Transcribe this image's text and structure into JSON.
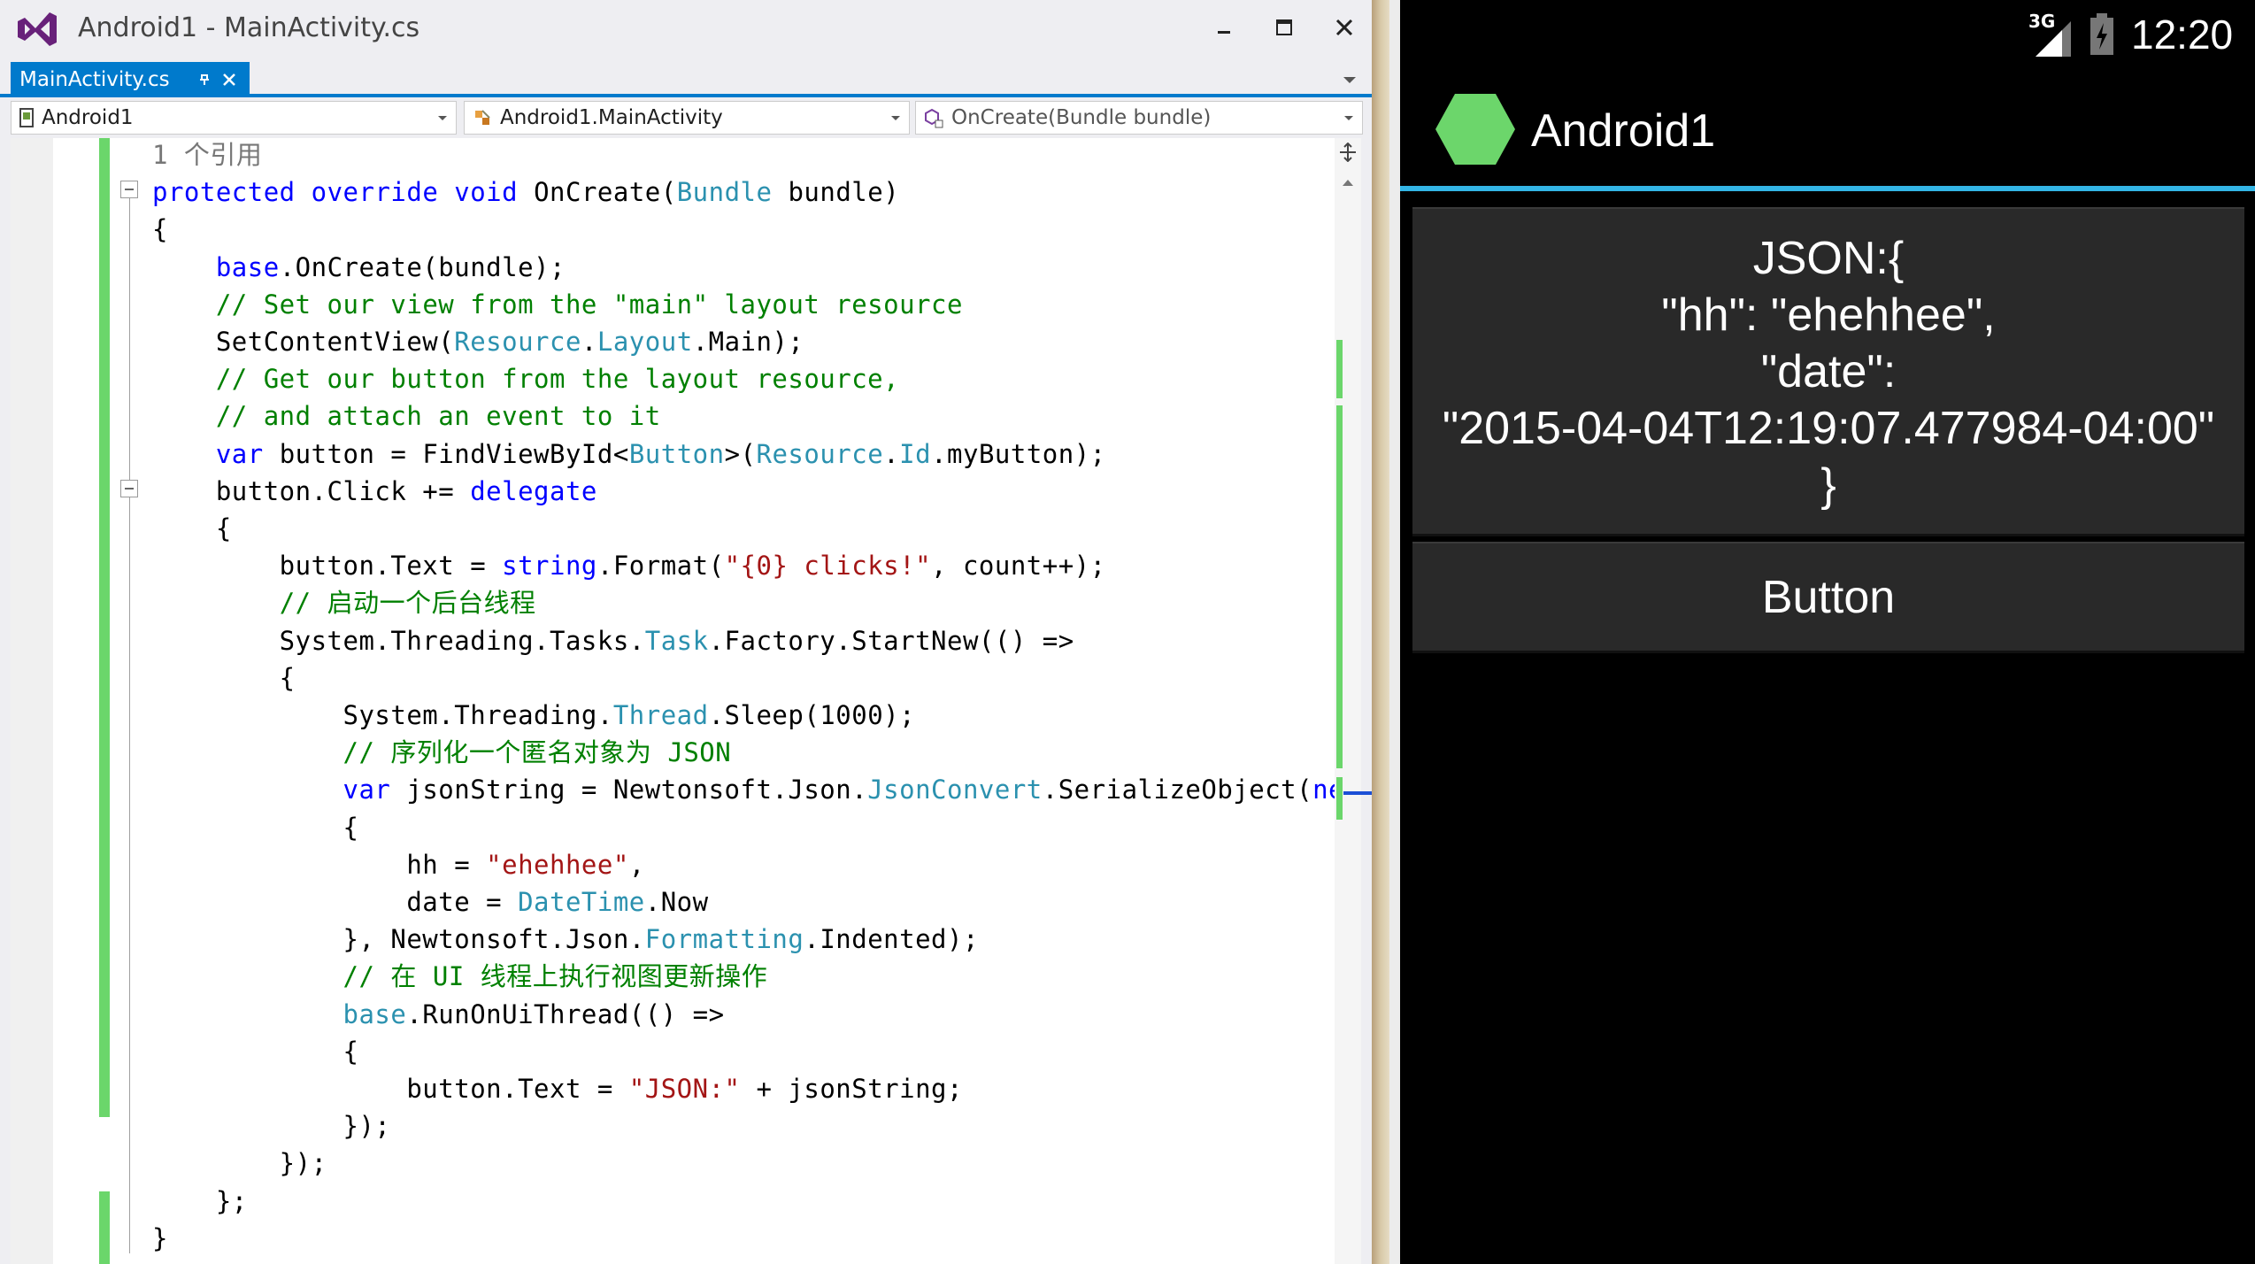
{
  "window": {
    "title": "Android1 - MainActivity.cs"
  },
  "tab": {
    "label": "MainActivity.cs"
  },
  "nav": {
    "project": "Android1",
    "class": "Android1.MainActivity",
    "member": "OnCreate(Bundle bundle)"
  },
  "code": {
    "lines": [
      [
        [
          "rf",
          "1 个引用"
        ]
      ],
      [
        [
          "kw",
          "protected"
        ],
        [
          "pl",
          " "
        ],
        [
          "kw",
          "override"
        ],
        [
          "pl",
          " "
        ],
        [
          "kw",
          "void"
        ],
        [
          "pl",
          " OnCreate("
        ],
        [
          "ty",
          "Bundle"
        ],
        [
          "pl",
          " bundle)"
        ]
      ],
      [
        [
          "pl",
          "{"
        ]
      ],
      [
        [
          "pl",
          "    "
        ],
        [
          "kw",
          "base"
        ],
        [
          "pl",
          ".OnCreate(bundle);"
        ]
      ],
      [
        [
          "pl",
          "    "
        ],
        [
          "cm",
          "// Set our view from the \"main\" layout resource"
        ]
      ],
      [
        [
          "pl",
          "    SetContentView("
        ],
        [
          "ty",
          "Resource"
        ],
        [
          "pl",
          "."
        ],
        [
          "ty",
          "Layout"
        ],
        [
          "pl",
          ".Main);"
        ]
      ],
      [
        [
          "pl",
          "    "
        ],
        [
          "cm",
          "// Get our button from the layout resource,"
        ]
      ],
      [
        [
          "pl",
          "    "
        ],
        [
          "cm",
          "// and attach an event to it"
        ]
      ],
      [
        [
          "pl",
          "    "
        ],
        [
          "kw",
          "var"
        ],
        [
          "pl",
          " button = FindViewById<"
        ],
        [
          "ty",
          "Button"
        ],
        [
          "pl",
          ">("
        ],
        [
          "ty",
          "Resource"
        ],
        [
          "pl",
          "."
        ],
        [
          "ty",
          "Id"
        ],
        [
          "pl",
          ".myButton);"
        ]
      ],
      [
        [
          "pl",
          "    button.Click += "
        ],
        [
          "kw",
          "delegate"
        ]
      ],
      [
        [
          "pl",
          "    {"
        ]
      ],
      [
        [
          "pl",
          "        button.Text = "
        ],
        [
          "kw",
          "string"
        ],
        [
          "pl",
          ".Format("
        ],
        [
          "st",
          "\"{0} clicks!\""
        ],
        [
          "pl",
          ", count++);"
        ]
      ],
      [
        [
          "pl",
          "        "
        ],
        [
          "cm",
          "// 启动一个后台线程"
        ]
      ],
      [
        [
          "pl",
          "        System.Threading.Tasks."
        ],
        [
          "ty",
          "Task"
        ],
        [
          "pl",
          ".Factory.StartNew(() =>"
        ]
      ],
      [
        [
          "pl",
          "        {"
        ]
      ],
      [
        [
          "pl",
          "            System.Threading."
        ],
        [
          "ty",
          "Thread"
        ],
        [
          "pl",
          ".Sleep(1000);"
        ]
      ],
      [
        [
          "pl",
          "            "
        ],
        [
          "cm",
          "// 序列化一个匿名对象为 JSON"
        ]
      ],
      [
        [
          "pl",
          "            "
        ],
        [
          "kw",
          "var"
        ],
        [
          "pl",
          " jsonString = Newtonsoft.Json."
        ],
        [
          "ty",
          "JsonConvert"
        ],
        [
          "pl",
          ".SerializeObject("
        ],
        [
          "kw",
          "new"
        ]
      ],
      [
        [
          "pl",
          "            {"
        ]
      ],
      [
        [
          "pl",
          "                hh = "
        ],
        [
          "st",
          "\"ehehhee\""
        ],
        [
          "pl",
          ","
        ]
      ],
      [
        [
          "pl",
          "                date = "
        ],
        [
          "ty",
          "DateTime"
        ],
        [
          "pl",
          ".Now"
        ]
      ],
      [
        [
          "pl",
          "            }, Newtonsoft.Json."
        ],
        [
          "ty",
          "Formatting"
        ],
        [
          "pl",
          ".Indented);"
        ]
      ],
      [
        [
          "pl",
          "            "
        ],
        [
          "cm",
          "// 在 UI 线程上执行视图更新操作"
        ]
      ],
      [
        [
          "pl",
          "            "
        ],
        [
          "ty",
          "base"
        ],
        [
          "pl",
          ".RunOnUiThread(() =>"
        ]
      ],
      [
        [
          "pl",
          "            {"
        ]
      ],
      [
        [
          "pl",
          "                button.Text = "
        ],
        [
          "st",
          "\"JSON:\""
        ],
        [
          "pl",
          " + jsonString;"
        ]
      ],
      [
        [
          "pl",
          "            });"
        ]
      ],
      [
        [
          "pl",
          "        });"
        ]
      ],
      [
        [
          "pl",
          "    };"
        ]
      ],
      [
        [
          "pl",
          "}"
        ]
      ]
    ]
  },
  "device": {
    "network": "3G",
    "time": "12:20",
    "app_title": "Android1",
    "json_button_text": "JSON:{\n\"hh\": \"ehehhee\",\n\"date\":\n\"2015-04-04T12:19:07.477984-04:00\"\n}",
    "button_label": "Button"
  },
  "colors": {
    "accent": "#007acc",
    "action_bar_line": "#33b5e5",
    "android_icon": "#6cd66b",
    "change_bar": "#6bd66b"
  }
}
